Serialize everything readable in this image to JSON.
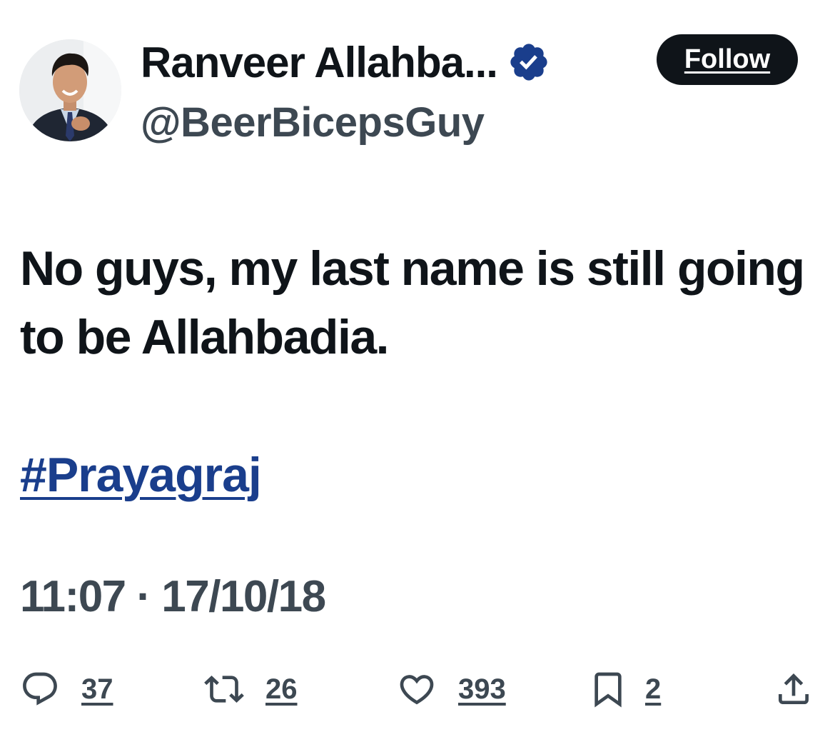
{
  "author": {
    "display_name": "Ranveer Allahba...",
    "handle": "@BeerBicepsGuy",
    "verified": true,
    "avatar_icon": "profile-photo"
  },
  "follow_button": {
    "label": "Follow"
  },
  "tweet": {
    "text": "No guys, my last name is still going to be Allahbadia.",
    "hashtag": "#Prayagraj",
    "timestamp": "11:07 · 17/10/18"
  },
  "actions": {
    "reply": {
      "icon": "reply-icon",
      "count": "37"
    },
    "retweet": {
      "icon": "retweet-icon",
      "count": "26"
    },
    "like": {
      "icon": "heart-icon",
      "count": "393"
    },
    "bookmark": {
      "icon": "bookmark-icon",
      "count": "2"
    },
    "share": {
      "icon": "share-icon"
    }
  },
  "colors": {
    "text": "#0f1419",
    "secondary_text": "#3d4852",
    "hashtag": "#1a3e8c",
    "verified_badge": "#1a3e8c",
    "follow_button_bg": "#0f1419"
  }
}
